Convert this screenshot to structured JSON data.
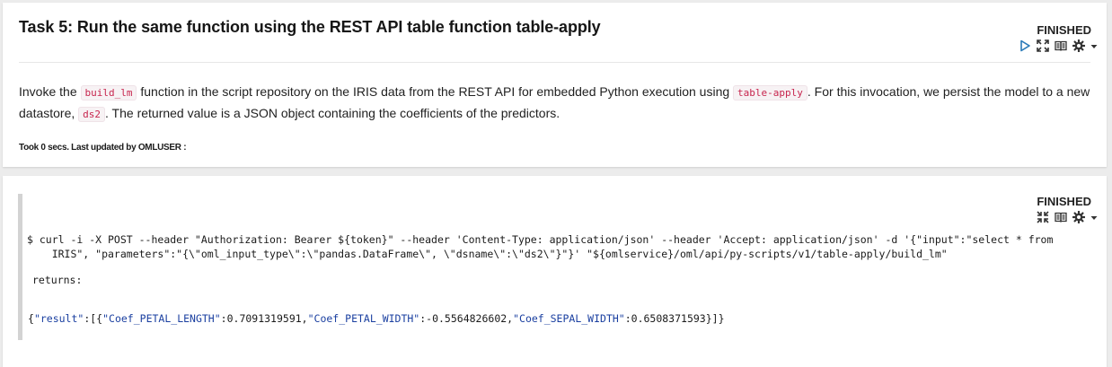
{
  "paragraph1": {
    "title": "Task 5: Run the same function using the REST API table function table-apply",
    "status": "FINISHED",
    "description": {
      "p1": "Invoke the ",
      "code1": "build_lm",
      "p2": " function in the script repository on the IRIS data from the REST API for embedded Python execution using ",
      "code2": "table-apply",
      "p3": ". For this invocation, we persist the model to a new datastore, ",
      "code3": "ds2",
      "p4": ". The returned value is a JSON object containing the coefficients of the predictors."
    },
    "footer": "Took 0 secs. Last updated by OMLUSER :",
    "toolbar_icons": [
      "run-icon",
      "expand-icon",
      "book-icon",
      "gear-icon",
      "caret-down-icon"
    ]
  },
  "paragraph2": {
    "status": "FINISHED",
    "toolbar_icons": [
      "collapse-icon",
      "book-icon",
      "gear-icon",
      "caret-down-icon"
    ],
    "command_line1": "$ curl -i -X POST --header \"Authorization: Bearer ${token}\" --header 'Content-Type: application/json' --header 'Accept: application/json' -d '{\"input\":\"select * from",
    "command_line2": "    IRIS\", \"parameters\":\"{\\\"oml_input_type\\\":\\\"pandas.DataFrame\\\", \\\"dsname\\\":\\\"ds2\\\"}\"}' \"${omlservice}/oml/api/py-scripts/v1/table-apply/build_lm\"",
    "returns_label": "returns:",
    "result": {
      "r0": "{",
      "k_result": "\"result\"",
      "r1": ":[{",
      "k1": "\"Coef_PETAL_LENGTH\"",
      "v1": ":0.7091319591,",
      "k2": "\"Coef_PETAL_WIDTH\"",
      "v2": ":-0.5564826602,",
      "k3": "\"Coef_SEPAL_WIDTH\"",
      "v3": ":0.6508371593}]}"
    }
  },
  "colors": {
    "background": "#ececec",
    "panel": "#ffffff",
    "run_icon": "#2a7ab8",
    "inline_code": "#c7254e",
    "json_key": "#1a3fa0"
  }
}
